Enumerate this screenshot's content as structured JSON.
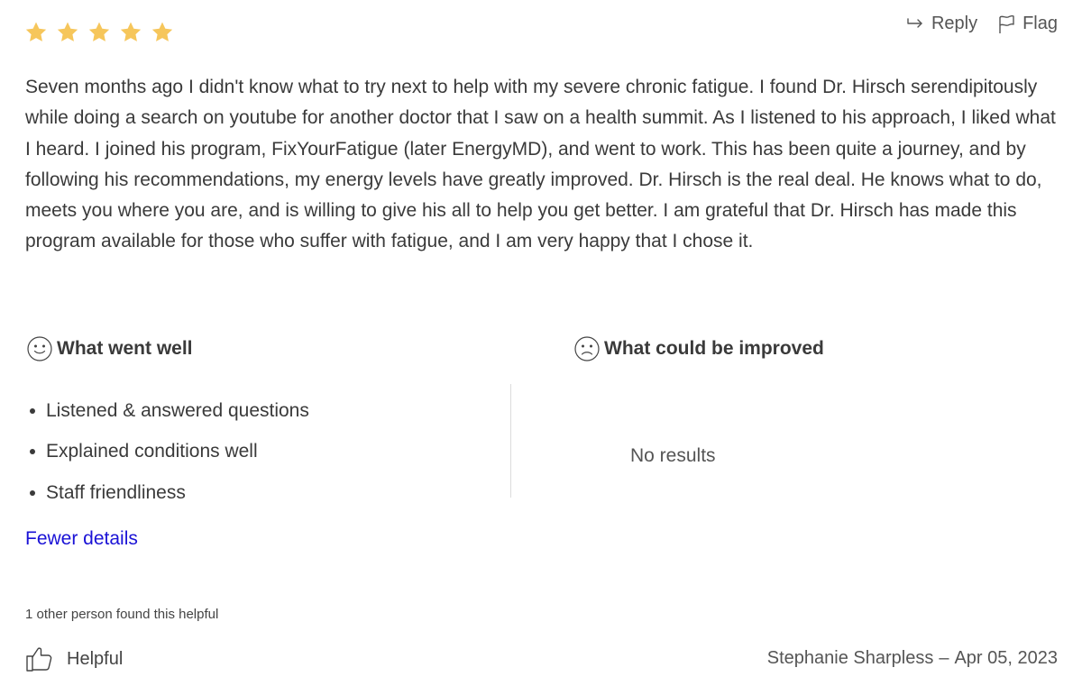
{
  "rating": {
    "stars": 5,
    "max_stars": 5,
    "star_color": "#f6c65b"
  },
  "actions": {
    "reply_label": "Reply",
    "flag_label": "Flag",
    "reply_icon": "reply-arrow-icon",
    "flag_icon": "flag-icon"
  },
  "review": {
    "text": "Seven months ago I didn't know what to try next to help with my severe chronic fatigue. I found Dr. Hirsch serendipitously while doing a search on youtube for another doctor that I saw on a health summit. As I listened to his approach, I liked what I heard. I joined his program, FixYourFatigue (later EnergyMD), and went to work. This has been quite a journey, and by following his recommendations, my energy levels have greatly improved. Dr. Hirsch is the real deal. He knows what to do, meets you where you are, and is willing to give his all to help you get better. I am grateful that Dr. Hirsch has made this program available for those who suffer with fatigue, and I am very happy that I chose it."
  },
  "went_well": {
    "title": "What went well",
    "icon": "smiley-face-icon",
    "items": [
      "Listened & answered questions",
      "Explained conditions well",
      "Staff friendliness"
    ]
  },
  "improve": {
    "title": "What could be improved",
    "icon": "sad-face-icon",
    "empty_text": "No results"
  },
  "details_toggle": {
    "label": "Fewer details",
    "color": "#1a12d6"
  },
  "helpful": {
    "count_text": "1 other person found this helpful",
    "button_label": "Helpful",
    "icon": "thumbs-up-icon"
  },
  "author": {
    "name": "Stephanie Sharpless",
    "separator": "–",
    "date": "Apr 05, 2023"
  }
}
